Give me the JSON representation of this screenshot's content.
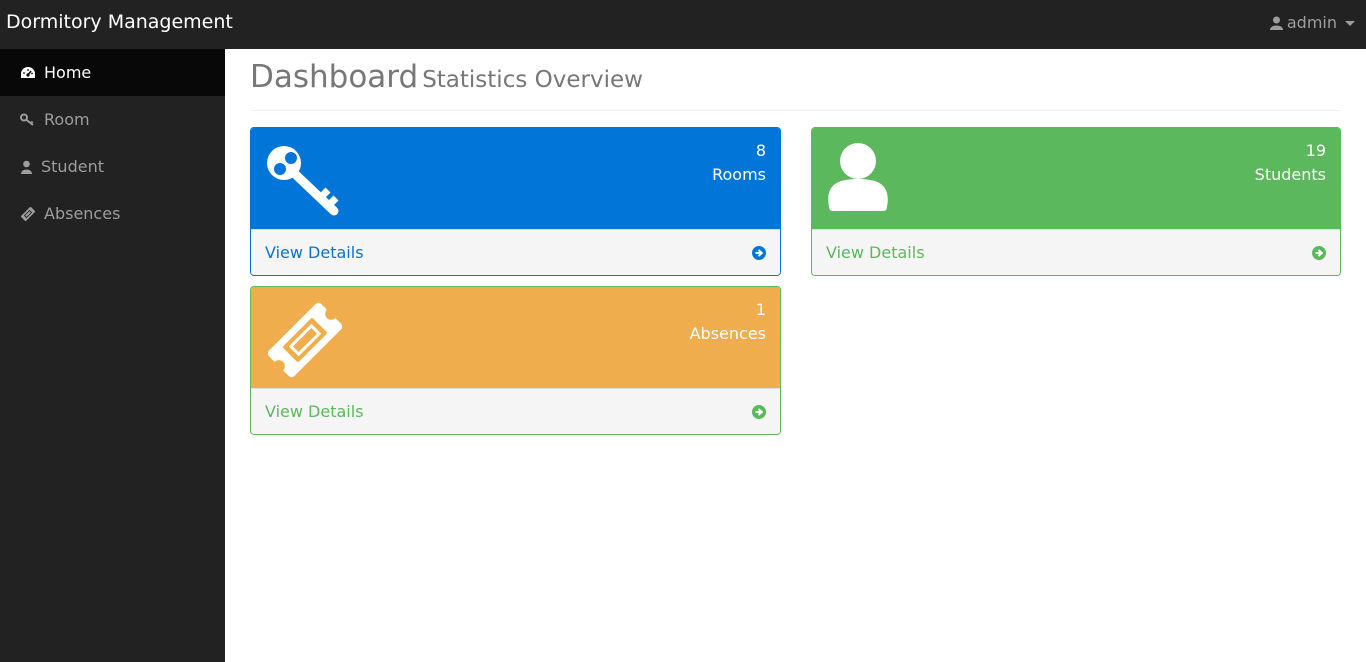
{
  "header": {
    "brand": "Dormitory Management",
    "user": "admin"
  },
  "sidebar": {
    "items": [
      {
        "label": "Home",
        "icon": "dashboard-icon"
      },
      {
        "label": "Room",
        "icon": "key-icon"
      },
      {
        "label": "Student",
        "icon": "user-icon"
      },
      {
        "label": "Absences",
        "icon": "ticket-icon"
      }
    ]
  },
  "page": {
    "title": "Dashboard",
    "subtitle": "Statistics Overview"
  },
  "panels": {
    "rooms": {
      "count": "8",
      "label": "Rooms",
      "footer": "View Details",
      "color": "#0275d8",
      "icon": "key-icon"
    },
    "students": {
      "count": "19",
      "label": "Students",
      "footer": "View Details",
      "color": "#5cb85c",
      "icon": "user-icon"
    },
    "absences": {
      "count": "1",
      "label": "Absences",
      "footer": "View Details",
      "color": "#f0ad4e",
      "icon": "ticket-icon"
    }
  },
  "colors": {
    "topbar": "#222222",
    "sidebar_active": "#080808",
    "primary": "#0275d8",
    "success": "#5cb85c",
    "warning": "#f0ad4e"
  }
}
